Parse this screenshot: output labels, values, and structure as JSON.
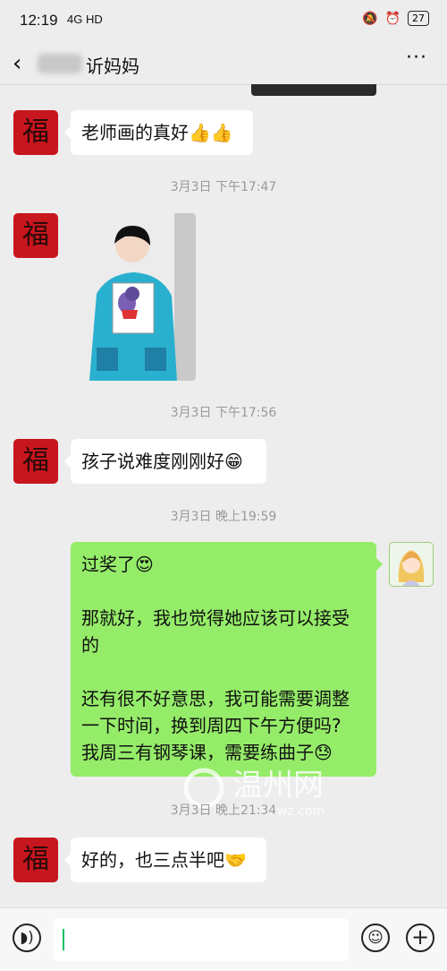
{
  "status_bar": {
    "time": "12:19",
    "network": "4G HD",
    "battery": "27"
  },
  "header": {
    "title": "䜣妈妈",
    "back_icon": "chevron-left-icon",
    "more_icon": "more-icon"
  },
  "messages": [
    {
      "text": "老师画的真好",
      "emoji": "👍👍"
    },
    {
      "timestamp": "3月3日 下午17:47"
    },
    {
      "image": "child-with-drawing"
    },
    {
      "timestamp": "3月3日 下午17:56"
    },
    {
      "text": "孩子说难度刚刚好",
      "emoji": "😁"
    },
    {
      "timestamp": "3月3日 晚上19:59"
    },
    {
      "lines": [
        "过奖了",
        "那就好，我也觉得她应该可以接受",
        "的",
        "还有很不好意思，我可能需要调整",
        "一下时间，换到周四下午方便吗?",
        "我周三有钢琴课，需要练曲子"
      ],
      "emoji1": "😍",
      "emoji2": "😓"
    },
    {
      "timestamp": "3月3日 晚上21:34"
    },
    {
      "text": "好的，也三点半吧",
      "emoji": "🤝"
    }
  ],
  "watermark": {
    "text": "温州网",
    "sub": "66wz.com"
  },
  "input_bar": {
    "voice_icon": "voice-icon",
    "emoji_icon": "emoji-icon",
    "add_icon": "plus-icon"
  }
}
